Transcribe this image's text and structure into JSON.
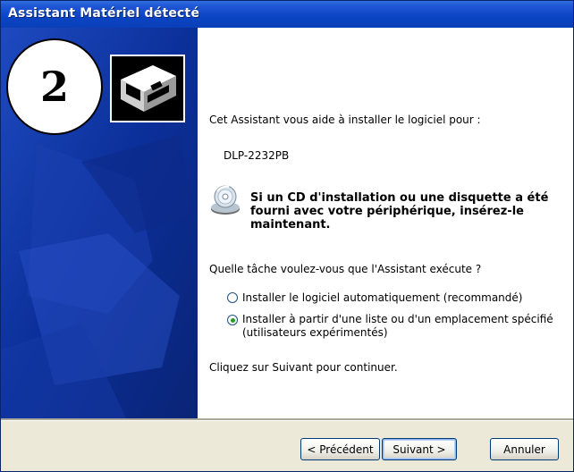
{
  "window": {
    "title": "Assistant Matériel détecté"
  },
  "overlay": {
    "step_number": "2"
  },
  "content": {
    "intro": "Cet Assistant vous aide à installer le logiciel pour :",
    "device_name": "DLP-2232PB",
    "cd_prompt_line1": "Si un CD d'installation ou une disquette a été",
    "cd_prompt_line2": "fourni avec votre périphérique, insérez-le",
    "cd_prompt_line3": "maintenant.",
    "question": "Quelle tâche voulez-vous que l'Assistant exécute ?",
    "options": [
      {
        "label": "Installer le logiciel automatiquement (recommandé)",
        "selected": false
      },
      {
        "label_line1": "Installer à partir d'une liste ou d'un emplacement spécifié",
        "label_line2": "(utilisateurs expérimentés)",
        "selected": true
      }
    ],
    "continue_hint": "Cliquez sur Suivant pour continuer."
  },
  "buttons": {
    "back": "< Précédent",
    "next": "Suivant >",
    "cancel": "Annuler"
  },
  "icons": {
    "hardware": "hardware-card-icon",
    "cd": "cd-disk-icon"
  },
  "colors": {
    "titlebar": "#0a44c4",
    "side_panel": "#0a2a8a",
    "footer": "#ece9d8"
  }
}
